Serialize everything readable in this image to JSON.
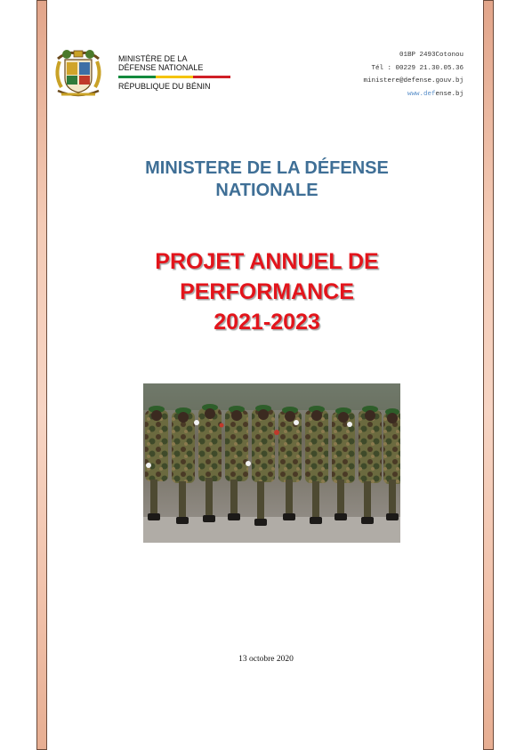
{
  "header": {
    "ministry_line1": "MINISTÈRE DE LA",
    "ministry_line2": "DÉFENSE NATIONALE",
    "republic": "RÉPUBLIQUE DU BÉNIN",
    "flag_colors": [
      "#138a3e",
      "#f5c400",
      "#d01f26"
    ]
  },
  "contact": {
    "address": "01BP 2493Cotonou",
    "phone": "Tél : 00229 21.30.05.36",
    "email": "ministere@defense.gouv.bj",
    "website_part1": "www.def",
    "website_part2": "ense.bj"
  },
  "title": {
    "ministry_line1": "MINISTERE DE LA DÉFENSE",
    "ministry_line2": "NATIONALE",
    "project_line1": "PROJET ANNUEL DE",
    "project_line2": "PERFORMANCE",
    "project_years": "2021-2023"
  },
  "colors": {
    "ministry_title": "#3f6f96",
    "project_title": "#e3141b"
  },
  "footer": {
    "date": "13 octobre 2020"
  }
}
